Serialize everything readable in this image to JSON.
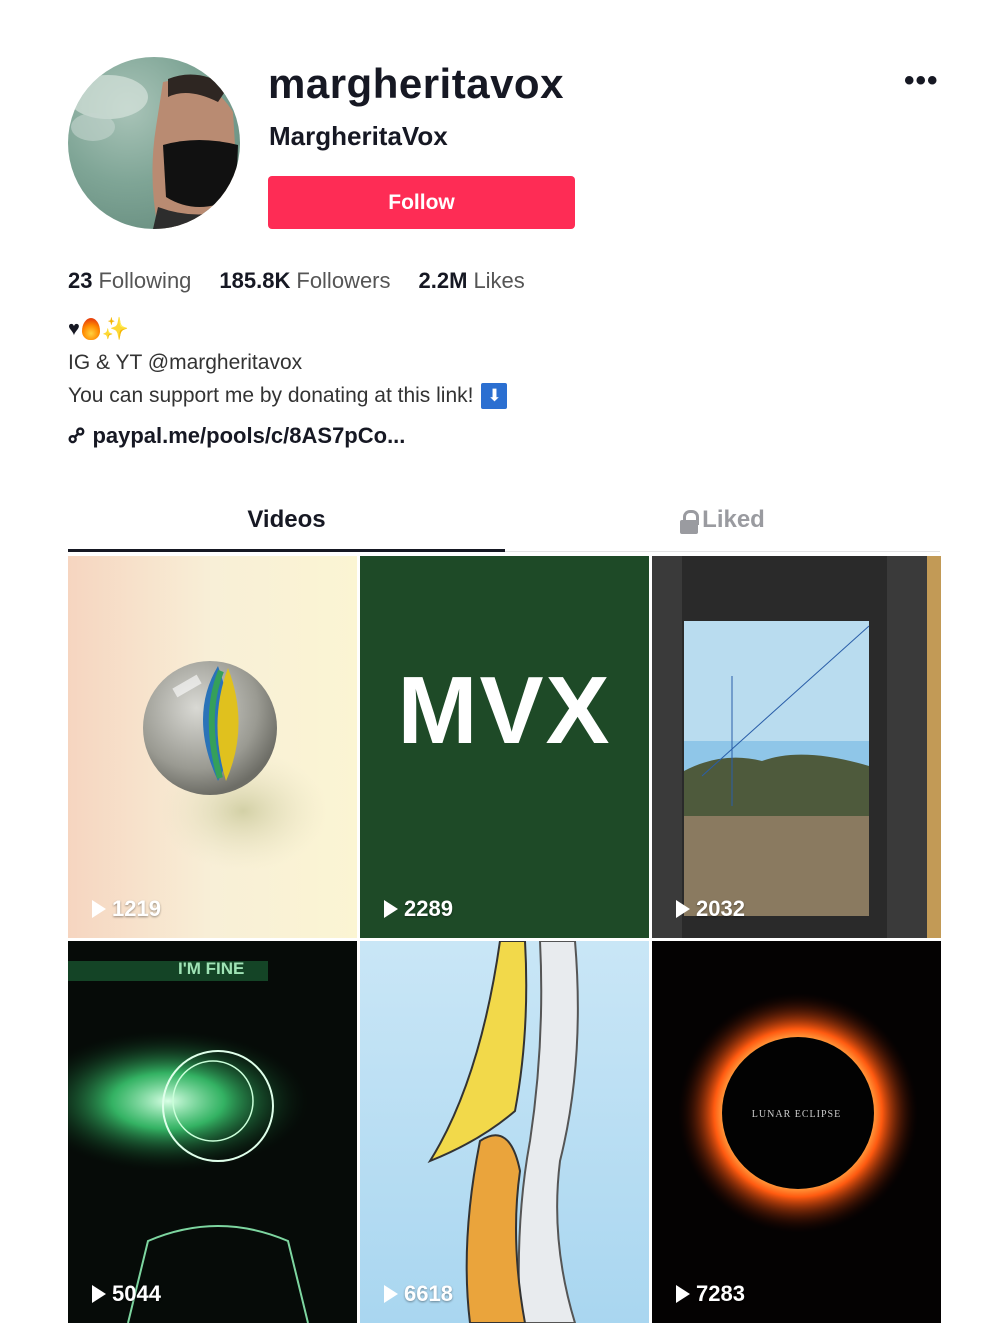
{
  "profile": {
    "username": "margherita​vox",
    "nickname": "MargheritaVox",
    "follow_label": "Follow",
    "more_label": "•••"
  },
  "stats": {
    "following_count": "23",
    "following_label": "Following",
    "followers_count": "185.8K",
    "followers_label": "Followers",
    "likes_count": "2.2M",
    "likes_label": "Likes"
  },
  "bio": {
    "emoji_heart": "♥",
    "emoji_sparkle": "✨",
    "line1": "IG & YT @margheritavox",
    "line2": "You can support me by donating at this link!",
    "line2_icon": "⬇",
    "link_text": "paypal.me/pools/c/8AS7pCo..."
  },
  "tabs": {
    "videos_label": "Videos",
    "liked_label": "Liked"
  },
  "videos": [
    {
      "views": "1219"
    },
    {
      "views": "2289",
      "text": "MVX"
    },
    {
      "views": "2032"
    },
    {
      "views": "5044",
      "text": "I'M FINE"
    },
    {
      "views": "6618"
    },
    {
      "views": "7283",
      "text": "LUNAR ECLIPSE"
    }
  ],
  "icons": {
    "more": "ellipsis-icon",
    "link": "link-icon",
    "lock": "lock-icon",
    "play": "play-icon"
  },
  "colors": {
    "follow_button": "#fe2c55"
  }
}
